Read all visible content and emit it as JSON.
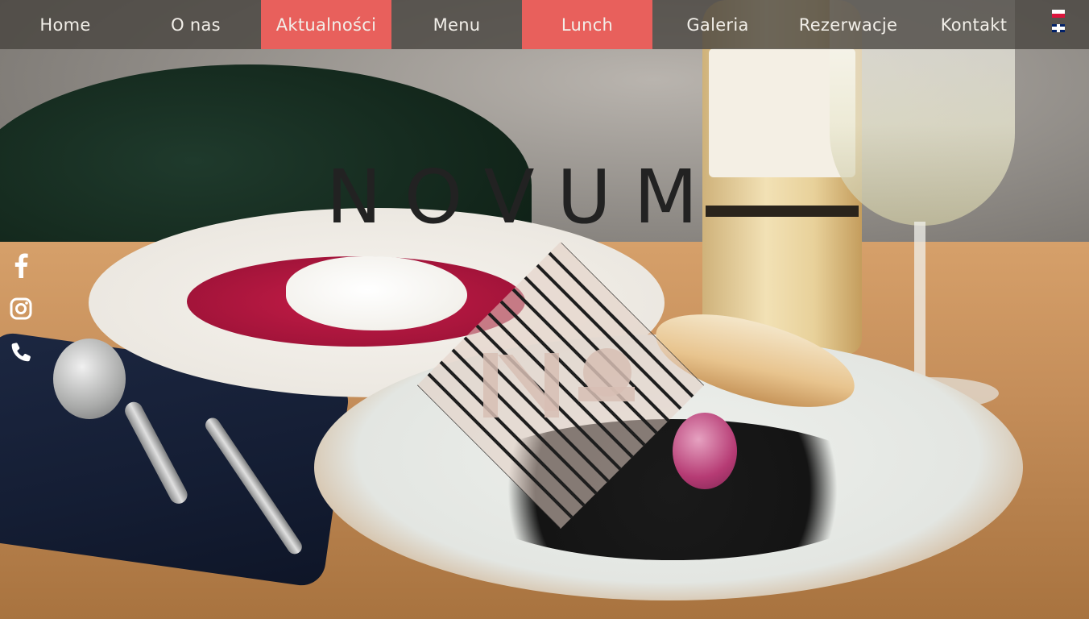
{
  "nav": {
    "items": [
      {
        "label": "Home"
      },
      {
        "label": "O nas"
      },
      {
        "label": "Aktualności"
      },
      {
        "label": "Menu"
      },
      {
        "label": "Lunch"
      },
      {
        "label": "Galeria"
      },
      {
        "label": "Rezerwacje"
      },
      {
        "label": "Kontakt"
      }
    ],
    "active_items": [
      "Aktualności",
      "Lunch"
    ],
    "active_color": "#e8605c",
    "bar_color": "#46423e"
  },
  "languages": [
    {
      "code": "pl",
      "icon": "poland-flag-icon"
    },
    {
      "code": "en",
      "icon": "uk-flag-icon"
    }
  ],
  "social": [
    {
      "icon": "facebook-icon"
    },
    {
      "icon": "instagram-icon"
    },
    {
      "icon": "phone-icon"
    }
  ],
  "logo": {
    "wordmark": "NOVUM",
    "emblem_icon": "striped-diamond-emblem-icon"
  }
}
